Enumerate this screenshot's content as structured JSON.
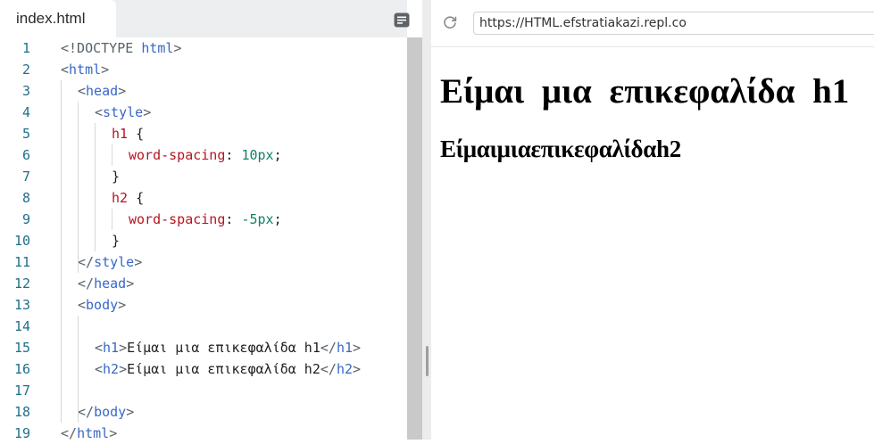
{
  "editor": {
    "tab_label": "index.html",
    "menu_icon": "document-menu-icon",
    "lines": [
      {
        "n": "1",
        "indent": 0,
        "tokens": [
          {
            "c": "p",
            "t": "<!DOCTYPE "
          },
          {
            "c": "t",
            "t": "html"
          },
          {
            "c": "p",
            "t": ">"
          }
        ]
      },
      {
        "n": "2",
        "indent": 0,
        "tokens": [
          {
            "c": "p",
            "t": "<"
          },
          {
            "c": "t",
            "t": "html"
          },
          {
            "c": "p",
            "t": ">"
          }
        ]
      },
      {
        "n": "3",
        "indent": 1,
        "tokens": [
          {
            "c": "p",
            "t": "<"
          },
          {
            "c": "t",
            "t": "head"
          },
          {
            "c": "p",
            "t": ">"
          }
        ]
      },
      {
        "n": "4",
        "indent": 2,
        "tokens": [
          {
            "c": "p",
            "t": "<"
          },
          {
            "c": "t",
            "t": "style"
          },
          {
            "c": "p",
            "t": ">"
          }
        ]
      },
      {
        "n": "5",
        "indent": 3,
        "tokens": [
          {
            "c": "s",
            "t": "h1"
          },
          {
            "c": "d",
            "t": " {"
          }
        ]
      },
      {
        "n": "6",
        "indent": 4,
        "tokens": [
          {
            "c": "s",
            "t": "word-spacing"
          },
          {
            "c": "d",
            "t": ": "
          },
          {
            "c": "n",
            "t": "10px"
          },
          {
            "c": "d",
            "t": ";"
          }
        ]
      },
      {
        "n": "7",
        "indent": 3,
        "tokens": [
          {
            "c": "d",
            "t": "}"
          }
        ]
      },
      {
        "n": "8",
        "indent": 3,
        "tokens": [
          {
            "c": "s",
            "t": "h2"
          },
          {
            "c": "d",
            "t": " {"
          }
        ]
      },
      {
        "n": "9",
        "indent": 4,
        "tokens": [
          {
            "c": "s",
            "t": "word-spacing"
          },
          {
            "c": "d",
            "t": ": "
          },
          {
            "c": "n",
            "t": "-5px"
          },
          {
            "c": "d",
            "t": ";"
          }
        ]
      },
      {
        "n": "10",
        "indent": 3,
        "tokens": [
          {
            "c": "d",
            "t": "}"
          }
        ]
      },
      {
        "n": "11",
        "indent": 1,
        "tokens": [
          {
            "c": "p",
            "t": "</"
          },
          {
            "c": "t",
            "t": "style"
          },
          {
            "c": "p",
            "t": ">"
          }
        ]
      },
      {
        "n": "12",
        "indent": 1,
        "tokens": [
          {
            "c": "p",
            "t": "</"
          },
          {
            "c": "t",
            "t": "head"
          },
          {
            "c": "p",
            "t": ">"
          }
        ]
      },
      {
        "n": "13",
        "indent": 1,
        "tokens": [
          {
            "c": "p",
            "t": "<"
          },
          {
            "c": "t",
            "t": "body"
          },
          {
            "c": "p",
            "t": ">"
          }
        ]
      },
      {
        "n": "14",
        "indent": 0,
        "tokens": []
      },
      {
        "n": "15",
        "indent": 2,
        "tokens": [
          {
            "c": "p",
            "t": "<"
          },
          {
            "c": "t",
            "t": "h1"
          },
          {
            "c": "p",
            "t": ">"
          },
          {
            "c": "d",
            "t": "Είμαι μια επικεφαλίδα h1"
          },
          {
            "c": "p",
            "t": "</"
          },
          {
            "c": "t",
            "t": "h1"
          },
          {
            "c": "p",
            "t": ">"
          }
        ]
      },
      {
        "n": "16",
        "indent": 2,
        "tokens": [
          {
            "c": "p",
            "t": "<"
          },
          {
            "c": "t",
            "t": "h2"
          },
          {
            "c": "p",
            "t": ">"
          },
          {
            "c": "d",
            "t": "Είμαι μια επικεφαλίδα h2"
          },
          {
            "c": "p",
            "t": "</"
          },
          {
            "c": "t",
            "t": "h2"
          },
          {
            "c": "p",
            "t": ">"
          }
        ]
      },
      {
        "n": "17",
        "indent": 0,
        "tokens": []
      },
      {
        "n": "18",
        "indent": 1,
        "tokens": [
          {
            "c": "p",
            "t": "</"
          },
          {
            "c": "t",
            "t": "body"
          },
          {
            "c": "p",
            "t": ">"
          }
        ]
      },
      {
        "n": "19",
        "indent": 0,
        "tokens": [
          {
            "c": "p",
            "t": "</"
          },
          {
            "c": "t",
            "t": "html"
          },
          {
            "c": "p",
            "t": ">"
          }
        ]
      }
    ]
  },
  "browser": {
    "refresh_icon": "refresh-icon",
    "url": "https://HTML.efstratiakazi.repl.co",
    "h1_text": "Είμαι μια επικεφαλίδα h1",
    "h2_text": "Είμαιμιαεπικεφαλίδαh2"
  },
  "colors": {
    "tag": "#3867c8",
    "punctuation": "#596269",
    "property": "#b7141f",
    "value": "#128264",
    "line_number": "#1f6f8b"
  }
}
